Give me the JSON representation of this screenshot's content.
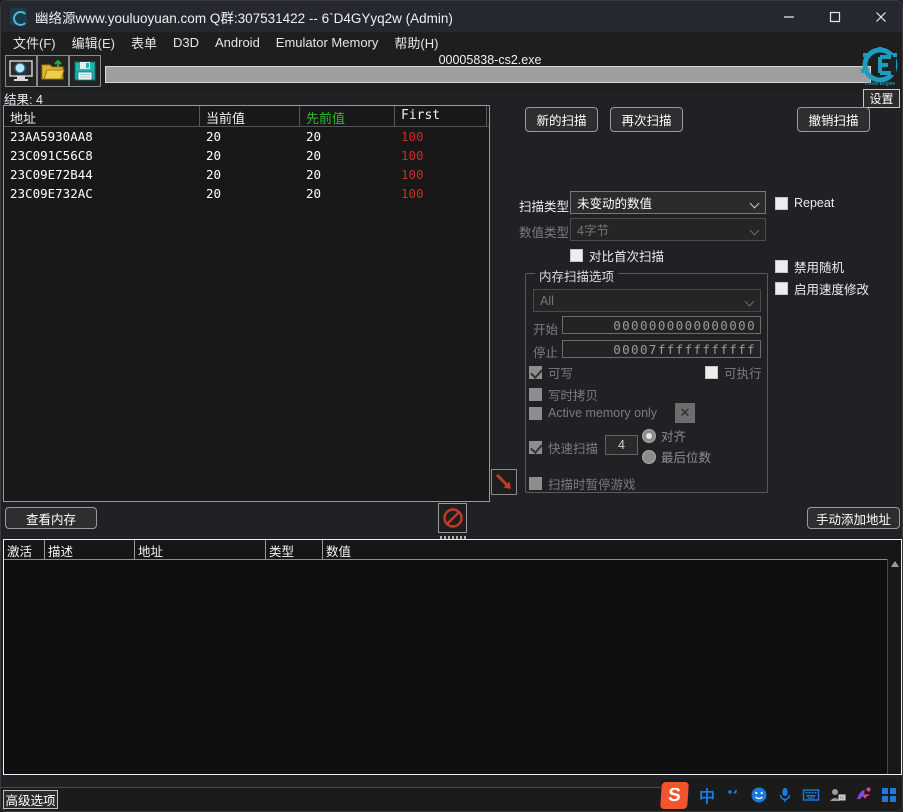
{
  "window": {
    "title": "幽络源www.youluoyuan.com Q群:307531422  --  6`D4GYyq2w (Admin)",
    "minimize_label": "minimize",
    "maximize_label": "maximize",
    "close_label": "close"
  },
  "menu": [
    {
      "label": "文件(F)"
    },
    {
      "label": "编辑(E)"
    },
    {
      "label": "表单"
    },
    {
      "label": "D3D"
    },
    {
      "label": "Android"
    },
    {
      "label": "Emulator Memory"
    },
    {
      "label": "帮助(H)"
    }
  ],
  "toolbar": {
    "open_process_icon": "monitor-magnifier-icon",
    "open_file_icon": "folder-open-icon",
    "save_icon": "floppy-disk-icon",
    "process_name": "00005838-cs2.exe",
    "settings_label": "设置",
    "logo_icon": "cheat-engine-logo"
  },
  "results": {
    "count_label": "结果: 4",
    "columns": [
      "地址",
      "当前值",
      "先前值",
      "First"
    ],
    "prev_color": "#2eb82e",
    "first_color": "#cc2b2b",
    "rows": [
      {
        "address": "23AA5930AA8",
        "current": "20",
        "previous": "20",
        "first": "100"
      },
      {
        "address": "23C091C56C8",
        "current": "20",
        "previous": "20",
        "first": "100"
      },
      {
        "address": "23C09E72B44",
        "current": "20",
        "previous": "20",
        "first": "100"
      },
      {
        "address": "23C09E732AC",
        "current": "20",
        "previous": "20",
        "first": "100"
      }
    ]
  },
  "scan": {
    "new_scan": "新的扫描",
    "next_scan": "再次扫描",
    "undo_scan": "撤销扫描",
    "scan_type_label": "扫描类型",
    "scan_type_value": "未变动的数值",
    "value_type_label": "数值类型",
    "value_type_value": "4字节",
    "repeat_label": "Repeat",
    "repeat_checked": false,
    "compare_first_label": "对比首次扫描",
    "compare_first_checked": false,
    "disable_random_label": "禁用随机",
    "disable_random_checked": false,
    "enable_speedhack_label": "启用速度修改",
    "enable_speedhack_checked": false,
    "memscan_group_title": "内存扫描选项",
    "region_value": "All",
    "start_label": "开始",
    "start_value": "0000000000000000",
    "stop_label": "停止",
    "stop_value": "00007fffffffffff",
    "writable_label": "可写",
    "writable_checked": true,
    "executable_label": "可执行",
    "executable_checked": false,
    "copyonwrite_label": "写时拷贝",
    "copyonwrite_checked": false,
    "active_memory_label": "Active memory only",
    "active_memory_checked": false,
    "clear_x_label": "✕",
    "fastscan_label": "快速扫描",
    "fastscan_checked": true,
    "fastscan_value": "4",
    "alignment_label": "对齐",
    "alignment_selected": true,
    "lastdigits_label": "最后位数",
    "lastdigits_selected": false,
    "pause_game_label": "扫描时暂停游戏",
    "pause_game_checked": false,
    "expand_arrow_icon": "red-arrow-down-right-icon"
  },
  "middle": {
    "browse_memory": "查看内存",
    "add_address_manually": "手动添加地址",
    "disable_icon": "no-entry-icon",
    "splitter_icon": "drag-handle"
  },
  "address_list": {
    "columns": [
      "激活",
      "描述",
      "地址",
      "类型",
      "数值"
    ],
    "rows": []
  },
  "statusbar": {
    "advanced_options": "高级选项"
  },
  "ime": {
    "logo": "S",
    "mode": "中",
    "punctuation_icon": "punctuation-icon",
    "emoji_icon": "emoji-icon",
    "mic_icon": "microphone-icon",
    "keyboard_icon": "keyboard-icon",
    "user_icon": "user-card-icon",
    "tools_icon": "toolbox-icon",
    "apps_icon": "apps-grid-icon"
  }
}
